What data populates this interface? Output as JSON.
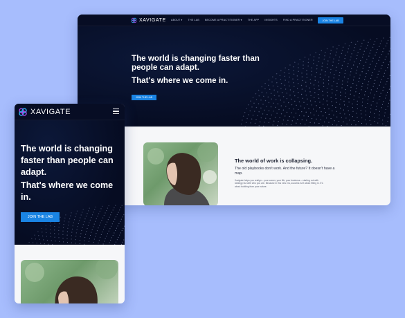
{
  "brand": {
    "name": "XAVIGATE",
    "accent": "#1a84e4",
    "hero_bg": "#060c22",
    "page_bg": "#a7bdfd"
  },
  "desktop": {
    "nav": {
      "items": [
        "ABOUT",
        "THE LAB",
        "BECOME A PRACTITIONER",
        "THE APP",
        "INSIGHTS",
        "FIND A PRACTITIONER"
      ],
      "join_label": "JOIN THE LAB"
    },
    "hero": {
      "headline": "The world is changing faster than people can adapt.",
      "subheadline": "That's where we come in.",
      "cta_label": "JOIN THE LAB"
    },
    "section": {
      "title": "The world of work is collapsing.",
      "subtitle": "The old playbooks don't work. And the future? It doesn't have a map.",
      "body": "Xavigate helps you realign – your career, your life, your business – starting not with strategy but with who you are. Because in this new era, success isn't about fitting in. It's about building from your nature."
    }
  },
  "mobile": {
    "hero": {
      "headline": "The world is changing faster than people can adapt.",
      "subheadline": "That's where we come in.",
      "cta_label": "JOIN THE LAB"
    }
  }
}
